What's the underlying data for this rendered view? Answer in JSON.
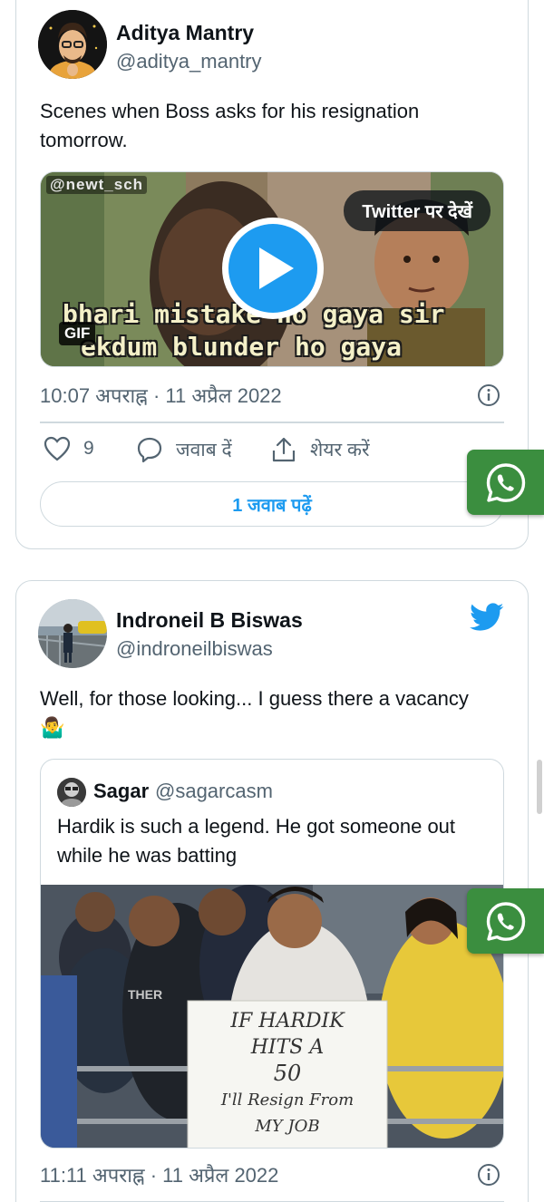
{
  "tweet1": {
    "name": "Aditya Mantry",
    "handle": "@aditya_mantry",
    "text": "Scenes when Boss asks for his resignation tomorrow.",
    "media": {
      "watermark": "@newt_sch",
      "view_on_twitter": "Twitter पर देखें",
      "caption_line1": "bhari mistake ho gaya sir",
      "caption_line2": "ekdum blunder ho gaya",
      "badge": "GIF"
    },
    "timestamp": "10:07 अपराह्न · 11 अप्रैल 2022",
    "likes": "9",
    "reply_label": "जवाब दें",
    "share_label": "शेयर करें",
    "read_replies": "1 जवाब पढ़ें"
  },
  "tweet2": {
    "name": "Indroneil B Biswas",
    "handle": "@indroneilbiswas",
    "text": "Well, for those looking... I guess there a vacancy",
    "emoji": "🤷‍♂️",
    "quote": {
      "name": "Sagar",
      "handle": "@sagarcasm",
      "text": "Hardik is such a legend. He got someone out while he was batting",
      "photo_sign": [
        "IF HARDIK",
        "HITS A",
        "50",
        "I'll Resign From",
        "MY JOB"
      ],
      "shirt_text": "THER"
    },
    "timestamp": "11:11 अपराह्न · 11 अप्रैल 2022"
  },
  "colors": {
    "twitter_blue": "#1d9bf0",
    "secondary_text": "#536471",
    "border": "#cfd9de",
    "whatsapp_green": "#3b8e3f"
  },
  "icons": [
    "heart-icon",
    "reply-icon",
    "share-icon",
    "info-icon",
    "twitter-bird-icon",
    "whatsapp-icon",
    "play-icon"
  ]
}
